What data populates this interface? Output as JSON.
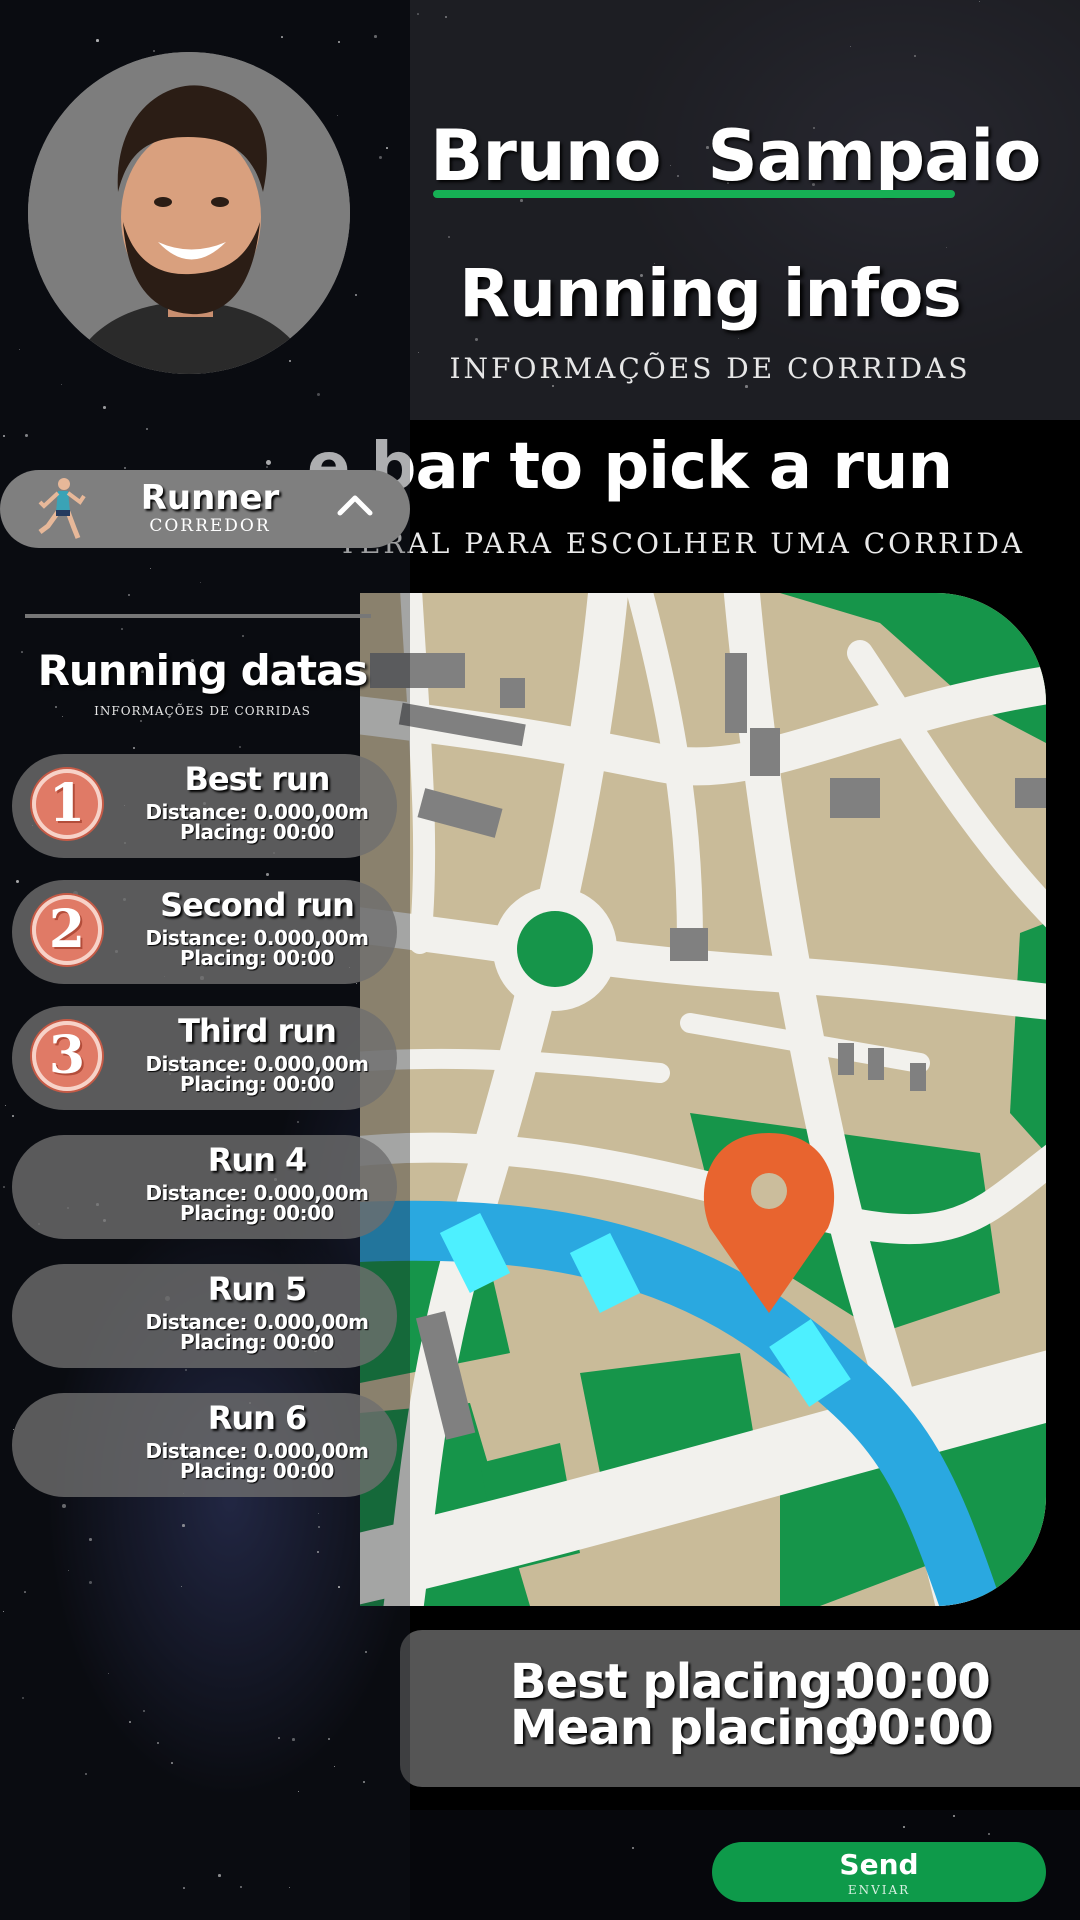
{
  "profile": {
    "name": "Bruno  Sampaio",
    "role": "Runner",
    "role_sub": "CORREDOR"
  },
  "header": {
    "title": "Running infos",
    "subtitle": "INFORMAÇÕES DE CORRIDAS"
  },
  "instruction": {
    "text": "e bar to pick a run",
    "sub": "TERAL PARA ESCOLHER UMA CORRIDA"
  },
  "sidebar": {
    "section_title": "Running datas",
    "section_sub": "INFORMAÇÕES DE CORRIDAS",
    "runs": [
      {
        "medal": "1",
        "title": "Best run",
        "distance": "Distance:  0.000,00m",
        "placing": "Placing: 00:00"
      },
      {
        "medal": "2",
        "title": "Second run",
        "distance": "Distance:  0.000,00m",
        "placing": "Placing: 00:00"
      },
      {
        "medal": "3",
        "title": "Third run",
        "distance": "Distance:  0.000,00m",
        "placing": "Placing: 00:00"
      },
      {
        "medal": "",
        "title": "Run 4",
        "distance": "Distance:  0.000,00m",
        "placing": "Placing: 00:00"
      },
      {
        "medal": "",
        "title": "Run 5",
        "distance": "Distance:  0.000,00m",
        "placing": "Placing: 00:00"
      },
      {
        "medal": "",
        "title": "Run 6",
        "distance": "Distance:  0.000,00m",
        "placing": "Placing: 00:00"
      }
    ]
  },
  "stats": {
    "best_label": "Best placing:",
    "best_value": "00:00",
    "mean_label": "Mean placing:",
    "mean_value": "00:00"
  },
  "send": {
    "label": "Send",
    "sub": "ENVIAR"
  },
  "colors": {
    "accent_green": "#16b054",
    "medal": "#e07a66",
    "map_pin": "#e8642f",
    "river": "#2aa8e0"
  },
  "icons": {
    "role": "runner-icon",
    "collapse": "chevron-up-icon",
    "map_pin": "map-pin-icon"
  }
}
